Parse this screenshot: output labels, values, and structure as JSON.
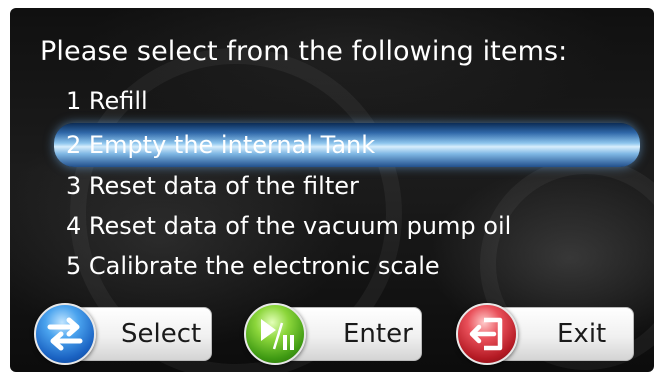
{
  "title": "Please select from the following items:",
  "menu": [
    {
      "label": "1 Refill",
      "selected": false
    },
    {
      "label": "2 Empty the internal Tank",
      "selected": true
    },
    {
      "label": "3 Reset data of the filter",
      "selected": false
    },
    {
      "label": "4 Reset data of the vacuum pump oil",
      "selected": false
    },
    {
      "label": "5 Calibrate the electronic scale",
      "selected": false
    }
  ],
  "buttons": {
    "select": {
      "label": "Select",
      "icon": "swap-arrows-icon",
      "color": "#1a62c2"
    },
    "enter": {
      "label": "Enter",
      "icon": "play-pause-icon",
      "color": "#3f9a13"
    },
    "exit": {
      "label": "Exit",
      "icon": "exit-door-icon",
      "color": "#b41a24"
    }
  },
  "colors": {
    "background": "#141414",
    "text": "#ffffff",
    "highlight": "#8ec6ee"
  }
}
